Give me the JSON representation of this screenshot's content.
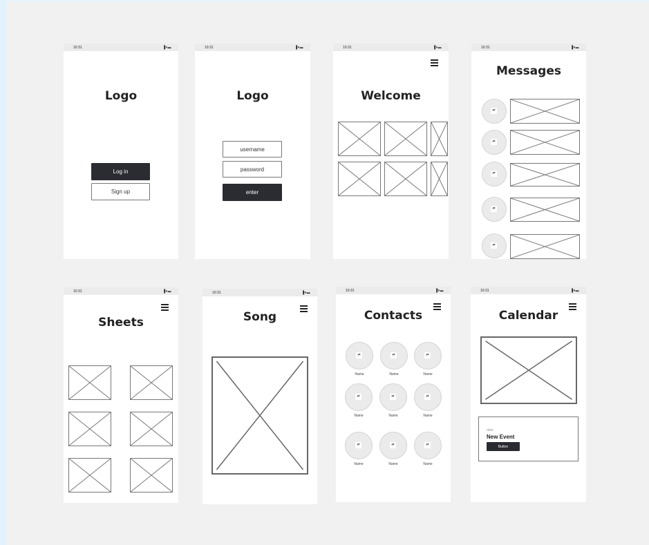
{
  "status_time": "10:31",
  "status_icons": "▐▾▬",
  "placeholder_icon": "⇄",
  "screens": {
    "login": {
      "logo": "Logo",
      "login_button": "Log in",
      "signup_button": "Sign up"
    },
    "credentials": {
      "logo": "Logo",
      "username": "username",
      "password": "password",
      "enter_button": "enter"
    },
    "welcome": {
      "title": "Welcome"
    },
    "messages": {
      "title": "Messages"
    },
    "sheets": {
      "title": "Sheets"
    },
    "song": {
      "title": "Song"
    },
    "contacts": {
      "title": "Contacts",
      "names": [
        "Name",
        "Name",
        "Name",
        "Name",
        "Name",
        "Name",
        "Name",
        "Name",
        "Name"
      ]
    },
    "calendar": {
      "title": "Calendar",
      "event_date": "date",
      "event_title": "New Event",
      "event_button": "Button"
    }
  }
}
